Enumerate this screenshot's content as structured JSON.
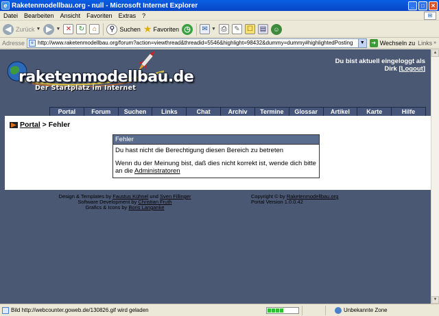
{
  "window": {
    "title": "Raketenmodellbau.org - null - Microsoft Internet Explorer"
  },
  "menu": [
    "Datei",
    "Bearbeiten",
    "Ansicht",
    "Favoriten",
    "Extras",
    "?"
  ],
  "toolbar": {
    "back": "Zurück",
    "search": "Suchen",
    "favorites": "Favoriten"
  },
  "address": {
    "label": "Adresse",
    "url": "http://www.raketenmodellbau.org/forum?action=viewthread&threadid=5546&highlight=98432&dummy=dummy#highlightedPosting",
    "go": "Wechseln zu",
    "links": "Links"
  },
  "site": {
    "logo_text": "raketenmodellbau.de",
    "logo_sub": "Der Startplatz im Internet",
    "login_line1": "Du bist aktuell eingeloggt als",
    "login_user": "Dirk",
    "login_logout": "Logout"
  },
  "nav": [
    "Portal",
    "Forum",
    "Suchen",
    "Links",
    "Chat",
    "Archiv",
    "Termine",
    "Glossar",
    "Artikel",
    "Karte",
    "Hilfe"
  ],
  "breadcrumb": {
    "portal": "Portal",
    "sep": " > ",
    "current": "Fehler"
  },
  "error": {
    "title": "Fehler",
    "message": "Du hast nicht die Berechtigung diesen Bereich zu betreten",
    "hint": "Wenn du der Meinung bist, daß dies nicht korrekt ist, wende dich bitte an die",
    "link": "Administratoren"
  },
  "footer": {
    "design_prefix": "Design & Templates by",
    "design_a": "Faustus Kühnel",
    "design_and": "und",
    "design_b": "Sven Fillinger",
    "dev_prefix": "Software Development by",
    "dev_name": "Christian Fruth",
    "gfx_prefix": "Grafics & Icons by",
    "gfx_name": "Boris Langanke",
    "copyright_prefix": "Copyright © by",
    "copyright_link": "Raketenmodellbau.org",
    "version": "Portal Version 1.0.0.42"
  },
  "status": {
    "text": "Bild http://webcounter.goweb.de/130826.gif wird geladen",
    "zone": "Unbekannte Zone",
    "progress": 0.55
  },
  "colors": {
    "page_bg": "#4b5873",
    "nav_bg": "#45567a",
    "box_header": "#5b6d8e",
    "titlebar": "#0a5fe4"
  }
}
